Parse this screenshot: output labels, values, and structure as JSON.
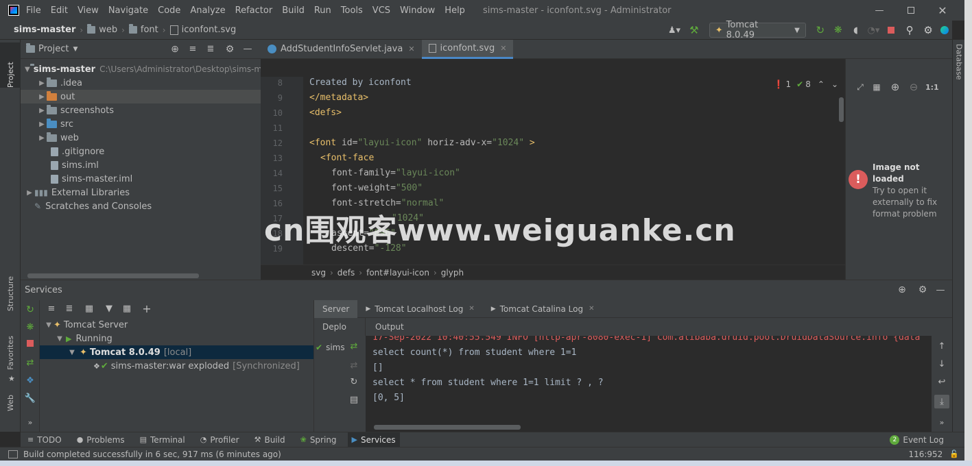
{
  "window": {
    "title": "sims-master - iconfont.svg - Administrator",
    "menu": [
      "File",
      "Edit",
      "View",
      "Navigate",
      "Code",
      "Analyze",
      "Refactor",
      "Build",
      "Run",
      "Tools",
      "VCS",
      "Window",
      "Help"
    ]
  },
  "navbar": {
    "crumbs": [
      "sims-master",
      "web",
      "font",
      "iconfont.svg"
    ],
    "run_config": "Tomcat 8.0.49"
  },
  "left_stripe": {
    "project": "Project",
    "structure": "Structure",
    "favorites": "Favorites",
    "web": "Web"
  },
  "right_stripe": {
    "database": "Database"
  },
  "project": {
    "title": "Project",
    "root": {
      "name": "sims-master",
      "path": "C:\\Users\\Administrator\\Desktop\\sims-m"
    },
    "items": [
      {
        "label": ".idea"
      },
      {
        "label": "out"
      },
      {
        "label": "screenshots"
      },
      {
        "label": "src"
      },
      {
        "label": "web"
      },
      {
        "label": ".gitignore"
      },
      {
        "label": "sims.iml"
      },
      {
        "label": "sims-master.iml"
      },
      {
        "label": "External Libraries"
      },
      {
        "label": "Scratches and Consoles"
      }
    ]
  },
  "editor": {
    "tabs": [
      {
        "label": "AddStudentInfoServlet.java"
      },
      {
        "label": "iconfont.svg"
      }
    ],
    "line_numbers": [
      "8",
      "9",
      "10",
      "11",
      "12",
      "13",
      "14",
      "15",
      "16",
      "17",
      "18",
      "19"
    ],
    "lines": {
      "l8": "Created by iconfont",
      "l9": "</metadata>",
      "l10": "<defs>",
      "l12_open": "<font",
      "l12_id_attr": " id=",
      "l12_id_val": "\"layui-icon\"",
      "l12_adv_attr": " horiz-adv-x=",
      "l12_adv_val": "\"1024\"",
      "l12_close": " >",
      "l13": "<font-face",
      "l14_attr": "font-family=",
      "l14_val": "\"layui-icon\"",
      "l15_attr": "font-weight=",
      "l15_val": "\"500\"",
      "l16_attr": "font-stretch=",
      "l16_val": "\"normal\"",
      "l17_val": "\"1024\"",
      "l18_attr": "ascent=",
      "l18_val": "\"896\"",
      "l19_attr": "descent=",
      "l19_val": "\"-128\""
    },
    "inspections": {
      "errors": "1",
      "warnings": "8"
    },
    "breadcrumb": [
      "svg",
      "defs",
      "font#layui-icon",
      "glyph"
    ],
    "watermark": "cn围观客www.weiguanke.cn"
  },
  "preview": {
    "zoom": "1:1",
    "title": "Image not loaded",
    "message": "Try to open it externally to fix format problem"
  },
  "services": {
    "title": "Services",
    "tree": [
      {
        "label": "Tomcat Server"
      },
      {
        "label": "Running"
      },
      {
        "label": "Tomcat 8.0.49",
        "suffix": "[local]"
      },
      {
        "label": "sims-master:war exploded",
        "suffix": "[Synchronized]"
      }
    ],
    "tabs": [
      "Server",
      "Tomcat Localhost Log",
      "Tomcat Catalina Log"
    ],
    "deploy_label": "Deplo",
    "deploy_item": "sims",
    "output_title": "Output",
    "output": [
      "17-Sep-2022 10:40:55.549 INFO [http-apr-8080-exec-1] com.alibaba.druid.pool.DruidDataSource.info {data",
      "select count(*) from student where 1=1",
      "[]",
      "select * from student where 1=1 limit ? , ?",
      "[0, 5]"
    ]
  },
  "bottom_tabs": [
    "TODO",
    "Problems",
    "Terminal",
    "Profiler",
    "Build",
    "Spring",
    "Services"
  ],
  "event_log": {
    "count": "2",
    "label": "Event Log"
  },
  "status": {
    "message": "Build completed successfully in 6 sec, 917 ms (6 minutes ago)",
    "position": "116:952"
  },
  "colors": {
    "accent": "#4a88c7",
    "error": "#db5c5c",
    "ok": "#5faa3c",
    "selection": "#0d293e"
  }
}
